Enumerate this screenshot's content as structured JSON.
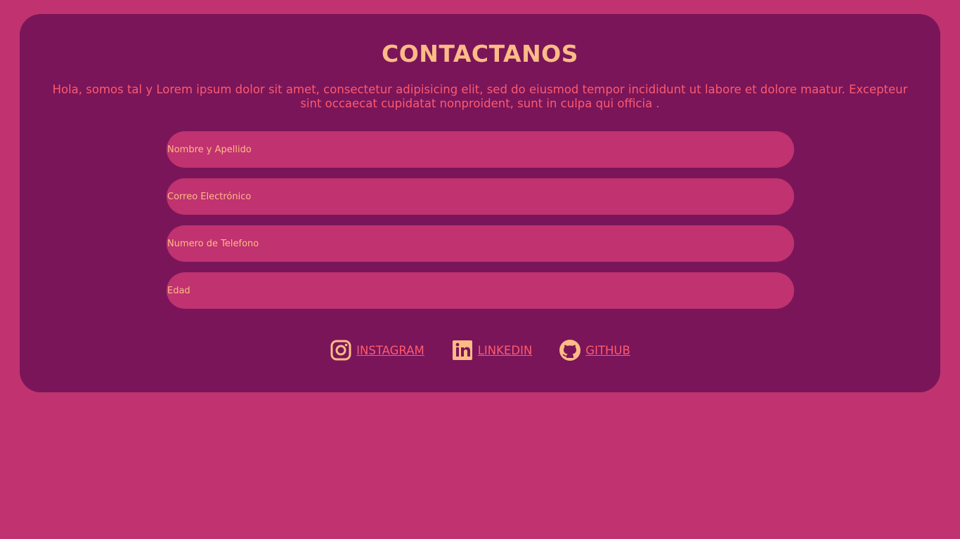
{
  "page": {
    "title": "CONTACTANOS",
    "intro": "Hola, somos tal y Lorem ipsum dolor sit amet, consectetur adipisicing elit, sed do eiusmod tempor incididunt ut labore et dolore maatur. Excepteur sint occaecat cupidatat nonproident, sunt in culpa qui officia ."
  },
  "form": {
    "name_placeholder": "Nombre y Apellido",
    "email_placeholder": "Correo Electrónico",
    "phone_placeholder": "Numero de Telefono",
    "age_placeholder": "Edad"
  },
  "socials": [
    {
      "label": "INSTAGRAM",
      "icon": "instagram-icon"
    },
    {
      "label": "LINKEDIN",
      "icon": "linkedin-icon"
    },
    {
      "label": "GITHUB",
      "icon": "github-icon"
    }
  ],
  "colors": {
    "background": "#c03270",
    "card": "#7a1559",
    "title": "#fcbb86",
    "text": "#ff5a6e",
    "field": "#c03270"
  }
}
